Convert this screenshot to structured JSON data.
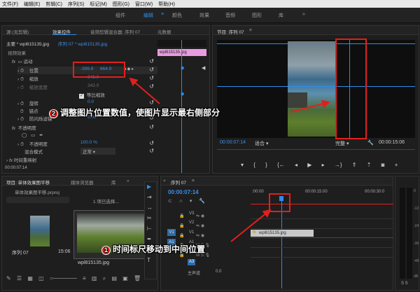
{
  "menu": [
    "文件(F)",
    "编辑(E)",
    "剪辑(C)",
    "序列(S)",
    "标记(M)",
    "图形(G)",
    "窗口(W)",
    "帮助(H)"
  ],
  "workspaces": {
    "items": [
      "组件",
      "编辑",
      "颜色",
      "效果",
      "音频",
      "图形",
      "库"
    ],
    "active_index": 1
  },
  "source_panel": {
    "tabs": [
      "源:(无剪辑)",
      "效果控件",
      "音频剪辑混合器: 序列 07",
      "元数据"
    ],
    "active_tab": 1,
    "clip_header": "主要 * wpl815135.jpg",
    "seq_header": "序列 07 * wpl815135.jpg",
    "mini_clip": "wpl815135.jpg",
    "section_video": "视频效果",
    "fx_motion": "运动",
    "rows": [
      {
        "label": "位置",
        "v1": "-306.6",
        "v2": "664.9"
      },
      {
        "label": "缩放",
        "v1": "343.0",
        "v2": ""
      },
      {
        "label": "缩放宽度",
        "v1": "343.0",
        "v2": ""
      },
      {
        "label": "等比缩放",
        "v1": "",
        "v2": ""
      },
      {
        "label": "旋转",
        "v1": "0.0",
        "v2": ""
      },
      {
        "label": "锚点",
        "v1": "",
        "v2": ""
      },
      {
        "label": "防闪烁滤镜",
        "v1": "0.00",
        "v2": ""
      }
    ],
    "fx_opacity": "不透明度",
    "opacity_label": "不透明度",
    "opacity_value": "100.0 %",
    "blend_label": "混合模式",
    "blend_value": "正常",
    "time_remap": "时间重映射",
    "timecode": "00:00:07:14"
  },
  "program_panel": {
    "title": "节目: 序列 07",
    "timecode": "00:00:07:14",
    "fit": "适合",
    "quality": "完整",
    "duration": "00:00:15:06"
  },
  "project_panel": {
    "tabs": [
      "项目: 单体效果图平移",
      "媒体浏览器",
      "库"
    ],
    "file": "单体效果图平移.prproj",
    "selected": "1 项已选择...",
    "items": [
      {
        "name": "序列 07",
        "duration": "15:06"
      },
      {
        "name": "wpl815135.jpg",
        "duration": ""
      }
    ]
  },
  "timeline_panel": {
    "title": "序列 07",
    "timecode": "00:00:07:14",
    "ruler": [
      ":00:00",
      "00:00:15:00",
      "00:00:30:0"
    ],
    "tracks": [
      "V3",
      "V2",
      "V1",
      "A1",
      "A2",
      "A3",
      "主声道"
    ],
    "src_patch": [
      "V1",
      "A1"
    ],
    "master_value": "0.0",
    "clip_name": "wpl815135.jpg"
  },
  "meters": {
    "labels": [
      "0",
      "-12",
      "-24",
      "-36",
      "-48",
      "dB"
    ],
    "solo": "S S"
  },
  "annotations": {
    "a2_num": "2",
    "a2_text": "调整图片位置数值，使图片显示最右侧部分",
    "a1_num": "1",
    "a1_text": "时间标尺移动到中间位置"
  },
  "colors": {
    "accent": "#2d8ceb",
    "callout": "#e0201c",
    "clip": "#c8c8c8",
    "mini_clip": "#e79be0"
  }
}
